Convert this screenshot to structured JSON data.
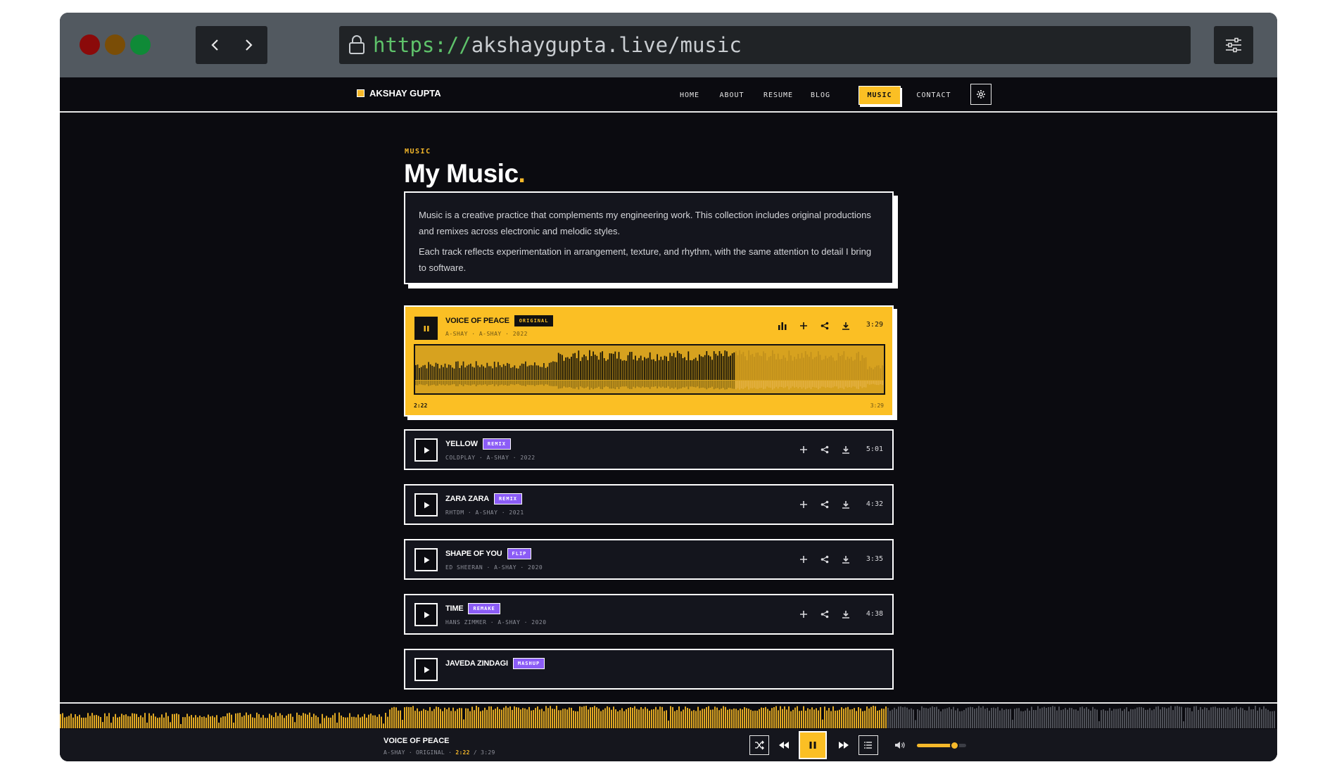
{
  "browser": {
    "url_protocol": "https://",
    "url_rest": "akshaygupta.live/music",
    "dot_colors": [
      "#8b0a0a",
      "#7a4d06",
      "#0f8a37"
    ]
  },
  "site": {
    "brand": "AKSHAY GUPTA",
    "nav": [
      {
        "label": "HOME",
        "active": false
      },
      {
        "label": "ABOUT",
        "active": false
      },
      {
        "label": "RESUME",
        "active": false
      },
      {
        "label": "BLOG",
        "active": false
      },
      {
        "label": "MUSIC",
        "active": true
      },
      {
        "label": "CONTACT",
        "active": false
      }
    ],
    "accent": "#fbbf24",
    "badge_color": "#8b5cf6"
  },
  "page": {
    "eyebrow": "MUSIC",
    "title": "My Music",
    "title_period": ".",
    "intro_p1": "Music is a creative practice that complements my engineering work. This collection includes original productions and remixes across electronic and melodic styles.",
    "intro_p2": "Each track reflects experimentation in arrangement, texture, and rhythm, with the same attention to detail I bring to software."
  },
  "tracks": [
    {
      "title": "VOICE OF PEACE",
      "badge": "ORIGINAL",
      "meta": "A-SHAY · A-SHAY · 2022",
      "duration": "3:29",
      "playing": true,
      "elapsed": "2:22",
      "progress": 0.68,
      "played_to": 0.3
    },
    {
      "title": "YELLOW",
      "badge": "REMIX",
      "meta": "COLDPLAY · A-SHAY · 2022",
      "duration": "5:01",
      "playing": false
    },
    {
      "title": "ZARA ZARA",
      "badge": "REMIX",
      "meta": "RHTDM · A-SHAY · 2021",
      "duration": "4:32",
      "playing": false
    },
    {
      "title": "SHAPE OF YOU",
      "badge": "FLIP",
      "meta": "ED SHEERAN · A-SHAY · 2020",
      "duration": "3:35",
      "playing": false
    },
    {
      "title": "TIME",
      "badge": "REMAKE",
      "meta": "HANS ZIMMER · A-SHAY · 2020",
      "duration": "4:38",
      "playing": false
    },
    {
      "title": "JAVEDA ZINDAGI",
      "badge": "MASHUP",
      "meta": "",
      "duration": "",
      "playing": false
    }
  ],
  "player": {
    "title": "VOICE OF PEACE",
    "meta_prefix": "A-SHAY · ORIGINAL · ",
    "current": "2:22",
    "separator": " / ",
    "total": "3:29",
    "progress": 0.68,
    "volume": 0.75
  }
}
